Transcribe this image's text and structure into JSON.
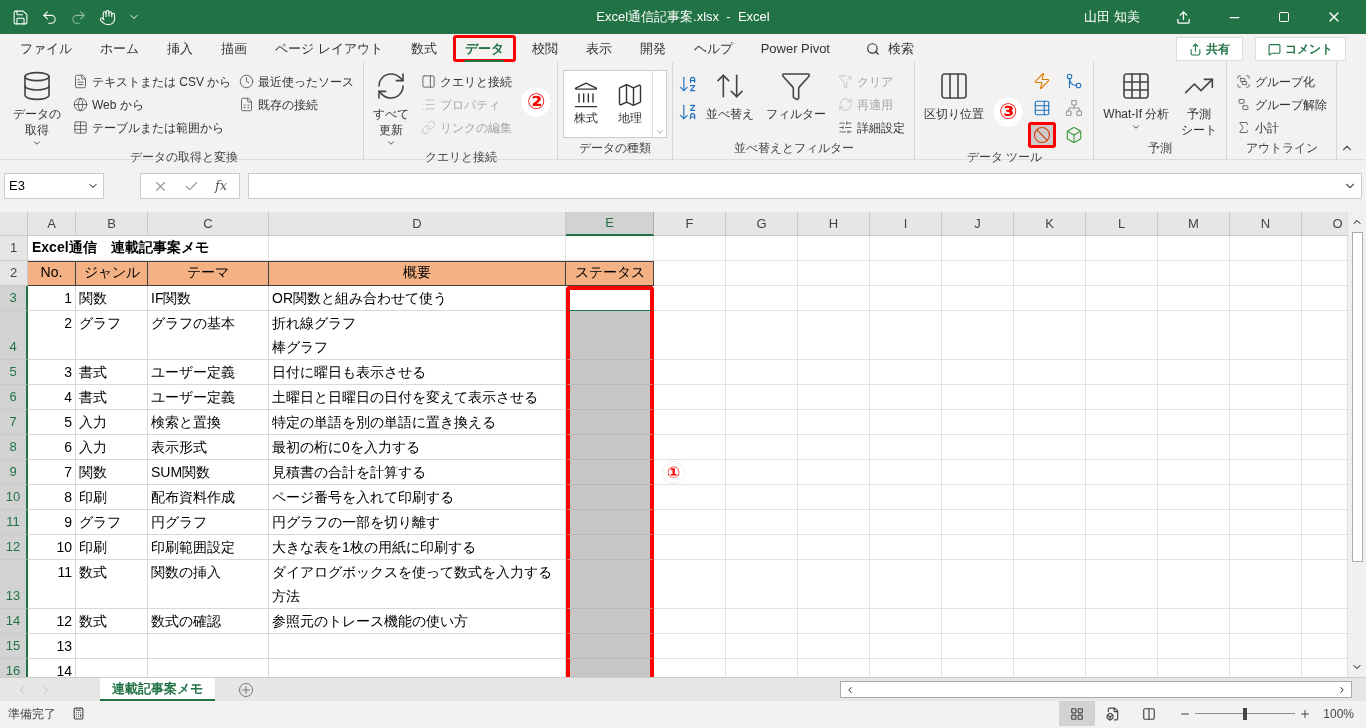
{
  "title_bar": {
    "title": "Excel通信記事案.xlsx  -  Excel",
    "user": "山田 知美"
  },
  "ribbon_tabs": [
    {
      "label": "ファイル",
      "selected": false,
      "framed": false
    },
    {
      "label": "ホーム",
      "selected": false,
      "framed": false
    },
    {
      "label": "挿入",
      "selected": false,
      "framed": false
    },
    {
      "label": "描画",
      "selected": false,
      "framed": false
    },
    {
      "label": "ページ レイアウト",
      "selected": false,
      "framed": false
    },
    {
      "label": "数式",
      "selected": false,
      "framed": false
    },
    {
      "label": "データ",
      "selected": true,
      "framed": true
    },
    {
      "label": "校閲",
      "selected": false,
      "framed": false
    },
    {
      "label": "表示",
      "selected": false,
      "framed": false
    },
    {
      "label": "開発",
      "selected": false,
      "framed": false
    },
    {
      "label": "ヘルプ",
      "selected": false,
      "framed": false
    },
    {
      "label": "Power Pivot",
      "selected": false,
      "framed": false
    }
  ],
  "search": {
    "label": "検索"
  },
  "share_button": "共有",
  "comment_button": "コメント",
  "ribbon_groups": [
    {
      "title": "データの取得と変換",
      "large": [
        {
          "lines": [
            "データの",
            "取得"
          ],
          "dropdown": true
        }
      ],
      "small": [
        {
          "label": "テキストまたは CSV から",
          "disabled": false
        },
        {
          "label": "Web から",
          "disabled": false
        },
        {
          "label": "テーブルまたは範囲から",
          "disabled": false
        },
        {
          "label": "最近使ったソース",
          "disabled": false
        },
        {
          "label": "既存の接続",
          "disabled": false
        }
      ]
    },
    {
      "title": "クエリと接続",
      "large": [
        {
          "lines": [
            "すべて",
            "更新"
          ],
          "dropdown": true
        }
      ],
      "small": [
        {
          "label": "クエリと接続",
          "disabled": false
        },
        {
          "label": "プロパティ",
          "disabled": true
        },
        {
          "label": "リンクの編集",
          "disabled": true
        }
      ]
    },
    {
      "title": "データの種類",
      "gallery": [
        {
          "label": "株式"
        },
        {
          "label": "地理"
        }
      ]
    },
    {
      "title": "並べ替えとフィルター",
      "large": [
        {
          "lines": [
            "並べ替え"
          ],
          "dropdown": false
        },
        {
          "lines": [
            "フィルター"
          ],
          "dropdown": false
        }
      ],
      "small": [
        {
          "label": "クリア",
          "disabled": true
        },
        {
          "label": "再適用",
          "disabled": true
        },
        {
          "label": "詳細設定",
          "disabled": false
        }
      ]
    },
    {
      "title": "データ ツール",
      "large": [
        {
          "lines": [
            "区切り位置"
          ],
          "dropdown": false
        }
      ],
      "tools": [
        {
          "framed": false
        },
        {
          "framed": false
        },
        {
          "framed": true
        },
        {
          "framed": false
        },
        {
          "framed": false
        },
        {
          "framed": false
        }
      ]
    },
    {
      "title": "予測",
      "large": [
        {
          "lines": [
            "What-If 分析"
          ],
          "dropdown": true
        },
        {
          "lines": [
            "予測",
            "シート"
          ],
          "dropdown": false
        }
      ]
    },
    {
      "title": "アウトライン",
      "small": [
        {
          "label": "グループ化",
          "disabled": false
        },
        {
          "label": "グループ解除",
          "disabled": false
        },
        {
          "label": "小計",
          "disabled": false
        }
      ]
    }
  ],
  "formula_bar": {
    "name_box": "E3",
    "fx": "fx"
  },
  "columns": [
    {
      "letter": "A",
      "selected": false
    },
    {
      "letter": "B",
      "selected": false
    },
    {
      "letter": "C",
      "selected": false
    },
    {
      "letter": "D",
      "selected": false
    },
    {
      "letter": "E",
      "selected": true
    },
    {
      "letter": "F",
      "selected": false
    },
    {
      "letter": "G",
      "selected": false
    },
    {
      "letter": "H",
      "selected": false
    },
    {
      "letter": "I",
      "selected": false
    },
    {
      "letter": "J",
      "selected": false
    },
    {
      "letter": "K",
      "selected": false
    },
    {
      "letter": "L",
      "selected": false
    },
    {
      "letter": "M",
      "selected": false
    },
    {
      "letter": "N",
      "selected": false
    },
    {
      "letter": "O",
      "selected": false
    }
  ],
  "rows": [
    {
      "number": "1",
      "kind": "title",
      "selected": false,
      "active": false,
      "framed": false,
      "title": "Excel通信　連載記事案メモ"
    },
    {
      "number": "2",
      "kind": "header",
      "selected": false,
      "active": false,
      "framed": false,
      "cells": [
        "No.",
        "ジャンル",
        "テーマ",
        "概要",
        "ステータス"
      ]
    },
    {
      "number": "3",
      "kind": "data",
      "selected": true,
      "active": true,
      "framed": true,
      "cells": [
        "1",
        "関数",
        "IF関数",
        [
          "OR関数と組み合わせて使う"
        ]
      ]
    },
    {
      "number": "4",
      "kind": "data",
      "selected": true,
      "active": false,
      "framed": true,
      "cells": [
        "2",
        "グラフ",
        "グラフの基本",
        [
          "折れ線グラフ",
          "棒グラフ"
        ]
      ]
    },
    {
      "number": "5",
      "kind": "data",
      "selected": true,
      "active": false,
      "framed": true,
      "cells": [
        "3",
        "書式",
        "ユーザー定義",
        [
          "日付に曜日も表示させる"
        ]
      ]
    },
    {
      "number": "6",
      "kind": "data",
      "selected": true,
      "active": false,
      "framed": true,
      "cells": [
        "4",
        "書式",
        "ユーザー定義",
        [
          "土曜日と日曜日の日付を変えて表示させる"
        ]
      ]
    },
    {
      "number": "7",
      "kind": "data",
      "selected": true,
      "active": false,
      "framed": true,
      "cells": [
        "5",
        "入力",
        "検索と置換",
        [
          "特定の単語を別の単語に置き換える"
        ]
      ]
    },
    {
      "number": "8",
      "kind": "data",
      "selected": true,
      "active": false,
      "framed": true,
      "cells": [
        "6",
        "入力",
        "表示形式",
        [
          "最初の桁に0を入力する"
        ]
      ]
    },
    {
      "number": "9",
      "kind": "data",
      "selected": true,
      "active": false,
      "framed": true,
      "cells": [
        "7",
        "関数",
        "SUM関数",
        [
          "見積書の合計を計算する"
        ]
      ]
    },
    {
      "number": "10",
      "kind": "data",
      "selected": true,
      "active": false,
      "framed": true,
      "cells": [
        "8",
        "印刷",
        "配布資料作成",
        [
          "ページ番号を入れて印刷する"
        ]
      ]
    },
    {
      "number": "11",
      "kind": "data",
      "selected": true,
      "active": false,
      "framed": true,
      "cells": [
        "9",
        "グラフ",
        "円グラフ",
        [
          "円グラフの一部を切り離す"
        ]
      ]
    },
    {
      "number": "12",
      "kind": "data",
      "selected": true,
      "active": false,
      "framed": true,
      "cells": [
        "10",
        "印刷",
        "印刷範囲設定",
        [
          "大きな表を1枚の用紙に印刷する"
        ]
      ]
    },
    {
      "number": "13",
      "kind": "data",
      "selected": true,
      "active": false,
      "framed": true,
      "cells": [
        "11",
        "数式",
        "関数の挿入",
        [
          "ダイアログボックスを使って数式を入力する方法"
        ]
      ]
    },
    {
      "number": "14",
      "kind": "data",
      "selected": true,
      "active": false,
      "framed": true,
      "cells": [
        "12",
        "数式",
        "数式の確認",
        [
          "参照元のトレース機能の使い方"
        ]
      ]
    },
    {
      "number": "15",
      "kind": "data",
      "selected": true,
      "active": false,
      "framed": true,
      "cells": [
        "13"
      ]
    },
    {
      "number": "16",
      "kind": "data",
      "selected": true,
      "active": false,
      "framed": true,
      "cells": [
        "14"
      ]
    }
  ],
  "sheet_tabs": [
    {
      "label": "連載記事案メモ",
      "selected": true
    }
  ],
  "status_bar": {
    "text": "準備完了",
    "zoom": "100%",
    "views": [
      {
        "selected": true
      },
      {
        "selected": false
      },
      {
        "selected": false
      }
    ],
    "zoom_slider": {
      "level": 0.5
    }
  },
  "step_markers": [
    "①",
    "②",
    "③"
  ]
}
